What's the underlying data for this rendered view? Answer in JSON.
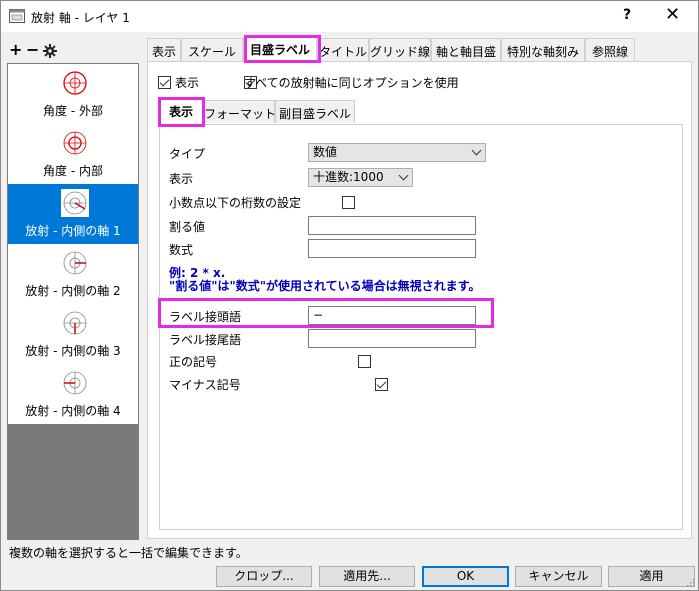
{
  "window": {
    "title": "放射 軸 - レイヤ 1",
    "help_label": "?",
    "close_label": "✕"
  },
  "toolbar": {
    "add_label": "+",
    "remove_label": "−",
    "settings_icon": "gear-icon"
  },
  "axes": [
    {
      "label": "角度 - 外部",
      "icon": "polar-outer-icon"
    },
    {
      "label": "角度 - 内部",
      "icon": "polar-inner-icon"
    },
    {
      "label": "放射 - 内側の軸 1",
      "icon": "radial-axis-icon",
      "selected": true
    },
    {
      "label": "放射 - 内側の軸 2",
      "icon": "radial-axis-icon"
    },
    {
      "label": "放射 - 内側の軸 3",
      "icon": "radial-axis-icon"
    },
    {
      "label": "放射 - 内側の軸 4",
      "icon": "radial-axis-icon"
    }
  ],
  "main_tabs": [
    "表示",
    "スケール",
    "目盛ラベル",
    "タイトル",
    "グリッド線",
    "軸と軸目盛",
    "特別な軸刻み",
    "参照線"
  ],
  "active_main_tab": "目盛ラベル",
  "top_options": {
    "show_label": "表示",
    "show_checked": true,
    "same_options_label": "すべての放射軸に同じオプションを使用",
    "same_options_checked": true
  },
  "sub_tabs": [
    "表示",
    "フォーマット",
    "副目盛ラベル"
  ],
  "active_sub_tab": "表示",
  "form": {
    "type_label": "タイプ",
    "type_value": "数値",
    "display_label": "表示",
    "display_value": "十進数:1000",
    "decimal_label": "小数点以下の桁数の設定",
    "decimal_checked": false,
    "divide_label": "割る値",
    "divide_value": "",
    "formula_label": "数式",
    "formula_value": "",
    "note_line1": "例: 2 * x.",
    "note_line2": "\"割る値\"は\"数式\"が使用されている場合は無視されます。",
    "prefix_label": "ラベル接頭語",
    "prefix_value": "−",
    "suffix_label": "ラベル接尾語",
    "suffix_value": "",
    "plus_label": "正の記号",
    "plus_checked": false,
    "minus_label": "マイナス記号",
    "minus_checked": true
  },
  "status_text": "複数の軸を選択すると一括で編集できます。",
  "buttons": {
    "crop": "クロップ...",
    "apply_to": "適用先...",
    "ok": "OK",
    "cancel": "キャンセル",
    "apply": "適用"
  },
  "colors": {
    "highlight": "#e22be2",
    "selection": "#0078d7",
    "note_text": "#0000c0"
  }
}
